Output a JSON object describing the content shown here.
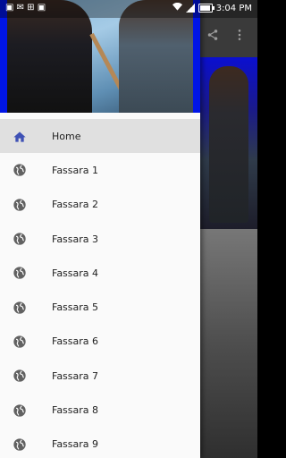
{
  "status_bar": {
    "time": "3:04 PM"
  },
  "menu": {
    "items": [
      {
        "label": "Home",
        "icon": "home-icon",
        "active": true
      },
      {
        "label": "Fassara 1",
        "icon": "globe-icon"
      },
      {
        "label": "Fassara 2",
        "icon": "globe-icon"
      },
      {
        "label": "Fassara 3",
        "icon": "globe-icon"
      },
      {
        "label": "Fassara 4",
        "icon": "globe-icon"
      },
      {
        "label": "Fassara 5",
        "icon": "globe-icon"
      },
      {
        "label": "Fassara 6",
        "icon": "globe-icon"
      },
      {
        "label": "Fassara 7",
        "icon": "globe-icon"
      },
      {
        "label": "Fassara 8",
        "icon": "globe-icon"
      },
      {
        "label": "Fassara 9",
        "icon": "globe-icon"
      }
    ]
  },
  "colors": {
    "home_icon": "#3f51b5",
    "globe_icon": "#616161",
    "active_bg": "#e0e0e0",
    "header_bg": "#0015e6"
  }
}
